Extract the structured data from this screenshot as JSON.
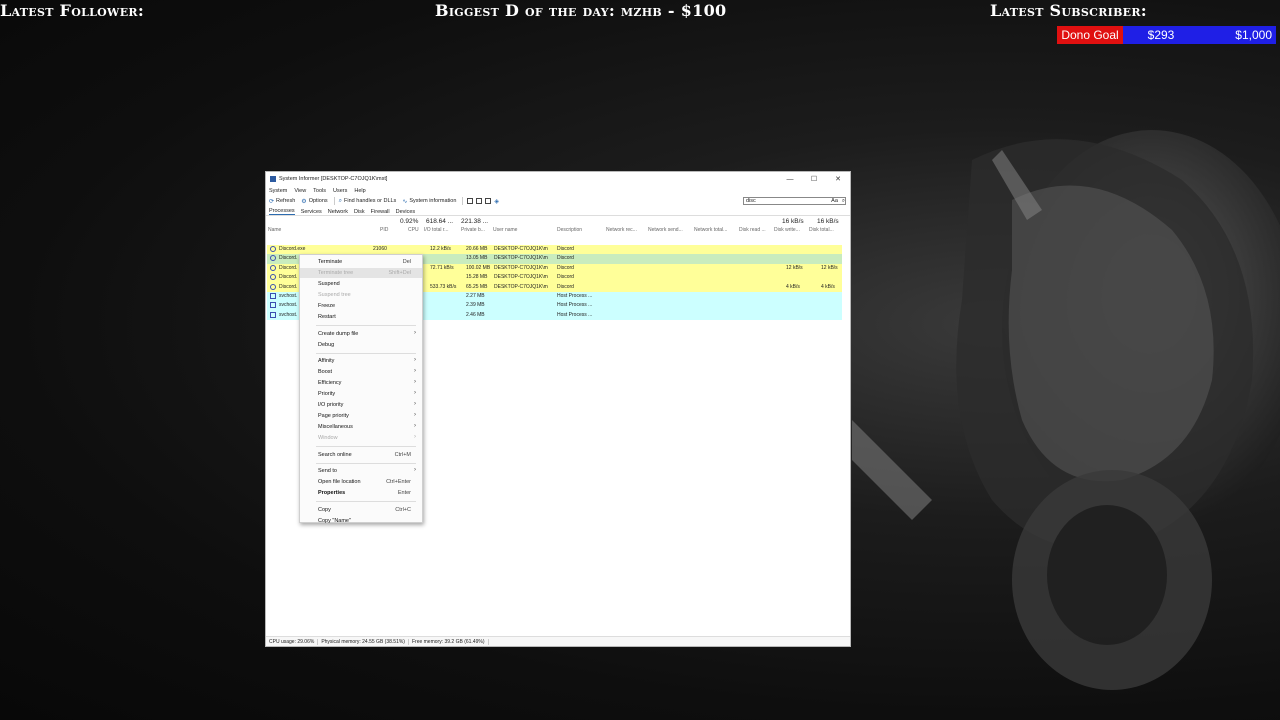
{
  "overlay": {
    "latest_follower": "Latest Follower:",
    "biggest_donation": "Biggest D of the day: mzhb - $100",
    "latest_subscriber": "Latest Subscriber:",
    "dono_goal_label": "Dono Goal",
    "dono_current": "$293",
    "dono_goal": "$1,000"
  },
  "window": {
    "title": "System Informer [DESKTOP-C7OJQ1K\\mst]",
    "controls": {
      "minimize": "—",
      "maximize": "☐",
      "close": "✕"
    },
    "menu": [
      "System",
      "View",
      "Tools",
      "Users",
      "Help"
    ],
    "toolbar": {
      "refresh": "Refresh",
      "options": "Options",
      "find_handles": "Find handles or DLLs",
      "system_information": "System information"
    },
    "search": {
      "value": "disc",
      "case_toggle": "Aa"
    },
    "tabs": [
      "Processes",
      "Services",
      "Network",
      "Disk",
      "Firewall",
      "Devices"
    ],
    "totals": {
      "cpu": "0.92%",
      "io": "618.64 ...",
      "private": "221.38 ...",
      "net_send": "16 kB/s",
      "disk_write": "16 kB/s"
    },
    "columns": [
      "Name",
      "PID",
      "CPU",
      "I/O total r...",
      "Private b...",
      "User name",
      "Description",
      "Network rec...",
      "Network send...",
      "Network total...",
      "Disk read ...",
      "Disk write...",
      "Disk total..."
    ],
    "rows": [
      {
        "name": "Discord.exe",
        "pid": "21060",
        "io": "12.2 kB/s",
        "priv": "20.66 MB",
        "user": "DESKTOP-C7OJQ1K\\m",
        "desc": "Discord",
        "dw": "",
        "dt": "",
        "color": "#ffff99"
      },
      {
        "name": "Discord.",
        "pid": "",
        "io": "",
        "priv": "13.05 MB",
        "user": "DESKTOP-C7OJQ1K\\m",
        "desc": "Discord",
        "dw": "",
        "dt": "",
        "color": "#c9ecbe"
      },
      {
        "name": "Discord.",
        "pid": "",
        "io": "72.71 kB/s",
        "priv": "100.02 MB",
        "user": "DESKTOP-C7OJQ1K\\m",
        "desc": "Discord",
        "dw": "12 kB/s",
        "dt": "12 kB/s",
        "color": "#ffff99"
      },
      {
        "name": "Discord.",
        "pid": "",
        "io": "",
        "priv": "15.28 MB",
        "user": "DESKTOP-C7OJQ1K\\m",
        "desc": "Discord",
        "dw": "",
        "dt": "",
        "color": "#ffff99"
      },
      {
        "name": "Discord.",
        "pid": "",
        "io": "533.73 kB/s",
        "priv": "65.25 MB",
        "user": "DESKTOP-C7OJQ1K\\m",
        "desc": "Discord",
        "dw": "4 kB/s",
        "dt": "4 kB/s",
        "color": "#ffff99"
      },
      {
        "name": "svchost.",
        "pid": "",
        "io": "",
        "priv": "2.27 MB",
        "user": "",
        "desc": "Host Process ...",
        "dw": "",
        "dt": "",
        "color": "#ccffff"
      },
      {
        "name": "svchost.",
        "pid": "",
        "io": "",
        "priv": "2.39 MB",
        "user": "",
        "desc": "Host Process ...",
        "dw": "",
        "dt": "",
        "color": "#ccffff"
      },
      {
        "name": "svchost.",
        "pid": "",
        "io": "",
        "priv": "2.46 MB",
        "user": "",
        "desc": "Host Process ...",
        "dw": "",
        "dt": "",
        "color": "#ccffff"
      }
    ],
    "status": {
      "cpu": "CPU usage: 29.06%",
      "physical": "Physical memory: 24.55 GB (38.51%)",
      "free": "Free memory: 39.2 GB (61.49%)"
    }
  },
  "context_menu": [
    {
      "label": "Terminate",
      "key": "Del"
    },
    {
      "label": "Terminate tree",
      "key": "Shift+Del",
      "disabled": true,
      "hover": true
    },
    {
      "label": "Suspend",
      "key": ""
    },
    {
      "label": "Suspend tree",
      "key": "",
      "disabled": true
    },
    {
      "label": "Freeze",
      "key": ""
    },
    {
      "label": "Restart",
      "key": ""
    },
    {
      "sep": true
    },
    {
      "label": "Create dump file",
      "submenu": true
    },
    {
      "label": "Debug"
    },
    {
      "sep": true
    },
    {
      "label": "Affinity",
      "submenu": true
    },
    {
      "label": "Boost",
      "submenu": true
    },
    {
      "label": "Efficiency",
      "submenu": true
    },
    {
      "label": "Priority",
      "submenu": true
    },
    {
      "label": "I/O priority",
      "submenu": true
    },
    {
      "label": "Page priority",
      "submenu": true
    },
    {
      "label": "Miscellaneous",
      "submenu": true
    },
    {
      "label": "Window",
      "submenu": true,
      "disabled": true
    },
    {
      "sep": true
    },
    {
      "label": "Search online",
      "key": "Ctrl+M"
    },
    {
      "sep": true
    },
    {
      "label": "Send to",
      "submenu": true
    },
    {
      "label": "Open file location",
      "key": "Ctrl+Enter"
    },
    {
      "label": "Properties",
      "key": "Enter",
      "bold": true
    },
    {
      "sep": true
    },
    {
      "label": "Copy",
      "key": "Ctrl+C"
    },
    {
      "label": "Copy \"Name\""
    }
  ]
}
